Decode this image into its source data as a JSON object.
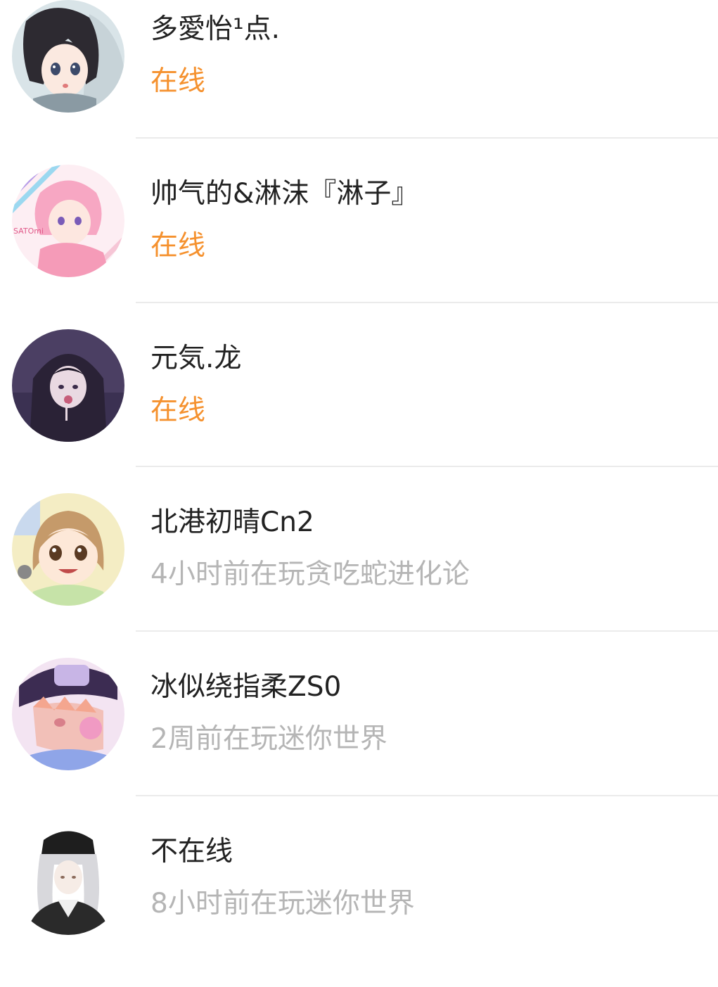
{
  "friends": [
    {
      "name": "多愛怡¹点.",
      "status": "在线",
      "online": true,
      "avatar_icon": "anime-girl-black-hair-avatar"
    },
    {
      "name": "帅气的&淋沫『淋子』",
      "status": "在线",
      "online": true,
      "avatar_icon": "anime-pink-hair-avatar",
      "avatar_text": "SATOmi"
    },
    {
      "name": "元気.龙",
      "status": "在线",
      "online": true,
      "avatar_icon": "anime-hooded-boy-avatar"
    },
    {
      "name": "北港初晴Cn2",
      "status": "4小时前在玩贪吃蛇进化论",
      "online": false,
      "avatar_icon": "anime-girl-short-hair-avatar"
    },
    {
      "name": "冰似绕指柔ZS0",
      "status": "2周前在玩迷你世界",
      "online": false,
      "avatar_icon": "anime-boy-cap-bubblegum-avatar"
    },
    {
      "name": "不在线",
      "status": "8小时前在玩迷你世界",
      "online": false,
      "avatar_icon": "anime-white-hair-cap-avatar"
    }
  ],
  "colors": {
    "online": "#f5912e",
    "offline": "#b5b5b5",
    "name": "#222222",
    "divider": "#ebebeb"
  }
}
